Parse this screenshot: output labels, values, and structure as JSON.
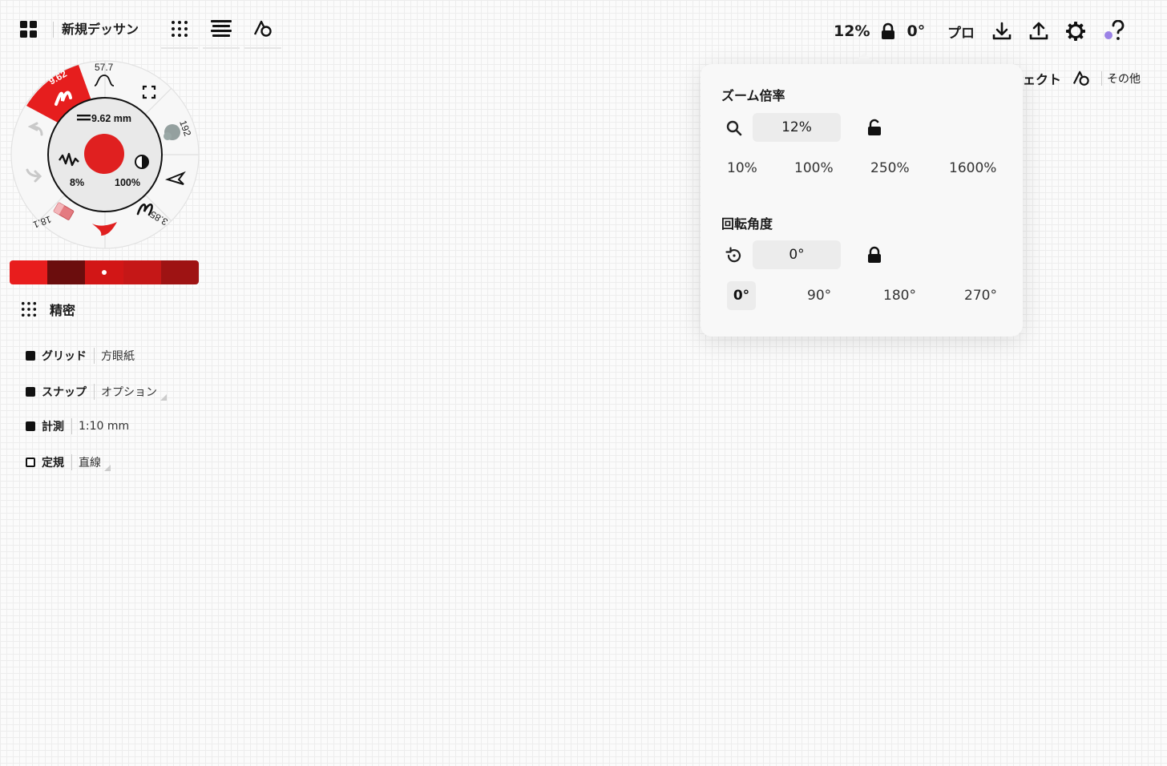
{
  "app": {
    "title": "新規デッサン"
  },
  "status": {
    "zoom": "12%",
    "rotation": "0°"
  },
  "right_toolbar": {
    "pro_label": "プロ"
  },
  "object_row": {
    "partial_label": "ジェクト",
    "other_label": "その他"
  },
  "zoom_popover": {
    "zoom_heading": "ズーム倍率",
    "zoom_value": "12%",
    "zoom_presets": [
      "10%",
      "100%",
      "250%",
      "1600%"
    ],
    "rotation_heading": "回転角度",
    "rotation_value": "0°",
    "rotation_presets": [
      "0°",
      "90°",
      "180°",
      "270°"
    ],
    "selected_rotation": "0°"
  },
  "brush": {
    "active_size": "9.62",
    "size_readout": "9.62 mm",
    "slot_top": "57.7",
    "slot_right": "192",
    "slot_bottom_right": "3.85",
    "slot_bottom_left": "18.1",
    "smoothing": "8%",
    "opacity": "100%",
    "current_color": "#e02020"
  },
  "palette": {
    "colors": [
      "#e81d1d",
      "#6b0d0d",
      "#d21616",
      "#c51717",
      "#9e1313"
    ],
    "selected_index": 2
  },
  "precision": {
    "label": "精密"
  },
  "options": [
    {
      "label": "グリッド",
      "value": "方眼紙",
      "on": true
    },
    {
      "label": "スナップ",
      "value": "オプション",
      "on": true
    },
    {
      "label": "計測",
      "value": "1:10 mm",
      "on": true
    },
    {
      "label": "定規",
      "value": "直線",
      "on": false
    }
  ]
}
